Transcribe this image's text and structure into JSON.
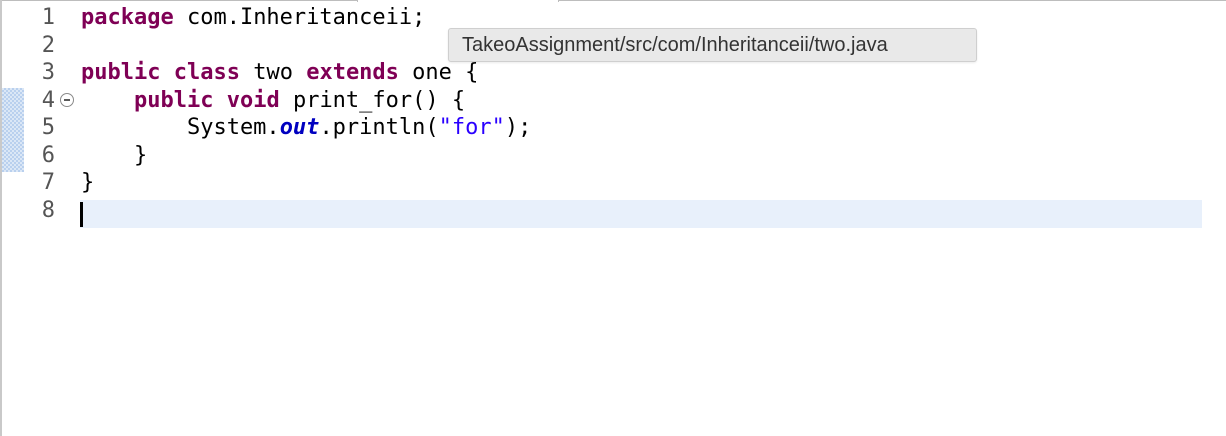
{
  "editor": {
    "line_numbers": [
      "1",
      "2",
      "3",
      "4",
      "5",
      "6",
      "7",
      "8"
    ],
    "lines": [
      [
        {
          "text": "package",
          "kind": "keyword"
        },
        {
          "text": " com.Inheritanceii;",
          "kind": "plain"
        }
      ],
      [],
      [
        {
          "text": "public",
          "kind": "keyword"
        },
        {
          "text": " ",
          "kind": "plain"
        },
        {
          "text": "class",
          "kind": "keyword"
        },
        {
          "text": " two ",
          "kind": "plain"
        },
        {
          "text": "extends",
          "kind": "keyword"
        },
        {
          "text": " one {",
          "kind": "plain"
        }
      ],
      [
        {
          "text": "    ",
          "kind": "plain"
        },
        {
          "text": "public",
          "kind": "keyword"
        },
        {
          "text": " ",
          "kind": "plain"
        },
        {
          "text": "void",
          "kind": "keyword"
        },
        {
          "text": " print_for() {",
          "kind": "plain"
        }
      ],
      [
        {
          "text": "        System.",
          "kind": "plain"
        },
        {
          "text": "out",
          "kind": "field"
        },
        {
          "text": ".println(",
          "kind": "plain"
        },
        {
          "text": "\"for\"",
          "kind": "string"
        },
        {
          "text": ");",
          "kind": "plain"
        }
      ],
      [
        {
          "text": "    }",
          "kind": "plain"
        }
      ],
      [
        {
          "text": "}",
          "kind": "plain"
        }
      ],
      []
    ],
    "fold_icon": "fold-collapse-icon",
    "current_line": 8
  },
  "tooltip": {
    "text": "TakeoAssignment/src/com/Inheritanceii/two.java"
  },
  "colors": {
    "keyword": "#7f0055",
    "field": "#0000c0",
    "string": "#2a00ff",
    "current_line_bg": "#e8f0fb",
    "tooltip_bg": "#e9e9e9"
  }
}
